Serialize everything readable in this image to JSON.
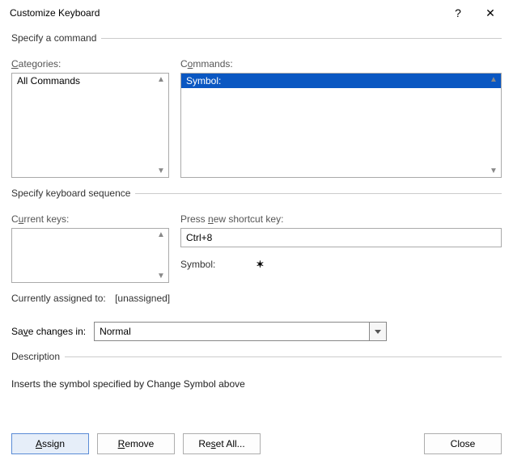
{
  "window": {
    "title": "Customize Keyboard",
    "help_glyph": "?",
    "close_glyph": "✕"
  },
  "specify_command": {
    "legend": "Specify a command",
    "categories_label": "Categories:",
    "categories": [
      "All Commands"
    ],
    "commands_label": "Commands:",
    "commands": [
      "Symbol:"
    ]
  },
  "specify_sequence": {
    "legend": "Specify keyboard sequence",
    "current_keys_label": "Current keys:",
    "current_keys": [],
    "press_new_label_pre": "Press ",
    "press_new_label_u": "n",
    "press_new_label_post": "ew shortcut key:",
    "new_key_value": "Ctrl+8",
    "symbol_label": "Symbol:",
    "symbol_glyph": "✶",
    "assigned_label": "Currently assigned to:",
    "assigned_value": "[unassigned]"
  },
  "save": {
    "label_pre": "Sa",
    "label_u": "v",
    "label_post": "e changes in:",
    "value": "Normal"
  },
  "description": {
    "legend": "Description",
    "text": "Inserts the symbol specified by Change Symbol above"
  },
  "buttons": {
    "assign": "Assign",
    "remove": "Remove",
    "reset": "Reset All...",
    "close": "Close"
  }
}
